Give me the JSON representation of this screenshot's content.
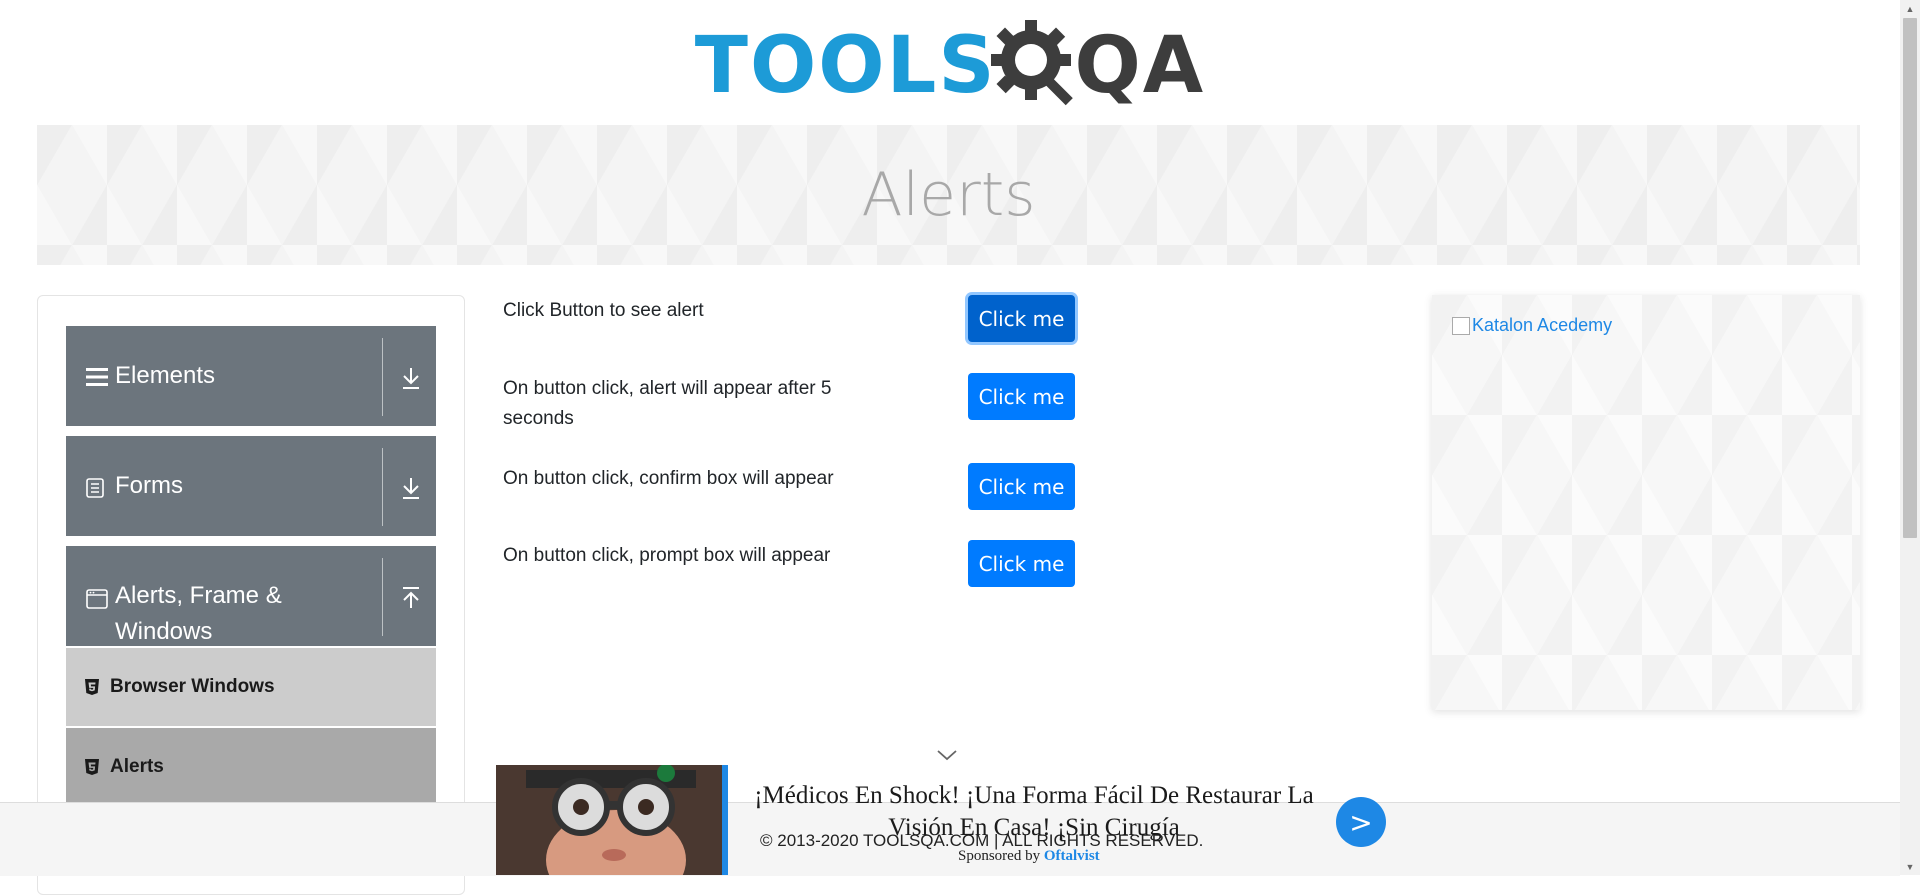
{
  "logo": {
    "part1": "TOOLS",
    "part2": "QA"
  },
  "page_title": "Alerts",
  "sidebar": {
    "groups": [
      {
        "label": "Elements",
        "icon": "hamburger-icon",
        "arrow": "download-arrow-icon"
      },
      {
        "label": "Forms",
        "icon": "document-icon",
        "arrow": "download-arrow-icon"
      },
      {
        "label": "Alerts, Frame & Windows",
        "label_line1": "Alerts, Frame &",
        "label_line2": "Windows",
        "icon": "window-icon",
        "arrow": "upload-arrow-icon"
      }
    ],
    "items": [
      {
        "label": "Browser Windows",
        "icon": "html5-icon"
      },
      {
        "label": "Alerts",
        "icon": "html5-icon"
      }
    ]
  },
  "alerts": [
    {
      "description": "Click Button to see alert",
      "button": "Click me"
    },
    {
      "description": "On button click, alert will appear after 5 seconds",
      "button": "Click me"
    },
    {
      "description": "On button click, confirm box will appear",
      "button": "Click me"
    },
    {
      "description": "On button click, prompt box will appear",
      "button": "Click me"
    }
  ],
  "ad_panel": {
    "alt": "Katalon Acedemy"
  },
  "footer": {
    "copyright": "© 2013-2020 TOOLSQA.COM | ALL RIGHTS RESERVED."
  },
  "sponsor": {
    "headline": "¡Médicos En Shock! ¡Una Forma Fácil De Restaurar La Visión En Casa! ¡Sin Cirugía",
    "by_label": "Sponsored by",
    "brand": "Oftalvist",
    "go_label": ">"
  },
  "colors": {
    "primary": "#007bff",
    "sidebar_group": "#6c757d",
    "sidebar_item": "#cccccc",
    "sidebar_item_active": "#a9a9a9",
    "logo_blue": "#1d9bd7",
    "logo_dark": "#3d3d3d"
  }
}
